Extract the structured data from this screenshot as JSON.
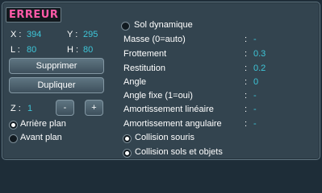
{
  "title": "ERREUR",
  "coords": {
    "x_label": "X :",
    "x_value": "394",
    "y_label": "Y :",
    "y_value": "295",
    "l_label": "L :",
    "l_value": "80",
    "h_label": "H :",
    "h_value": "80"
  },
  "buttons": {
    "delete": "Supprimer",
    "duplicate": "Dupliquer",
    "minus": "-",
    "plus": "+"
  },
  "z": {
    "label": "Z :",
    "value": "1"
  },
  "layer": {
    "background_label": "Arrière plan",
    "foreground_label": "Avant plan",
    "selected": "background"
  },
  "dynamic_ground": {
    "label": "Sol dynamique",
    "checked": false
  },
  "properties": [
    {
      "label": "Masse (0=auto)",
      "value": "-"
    },
    {
      "label": "Frottement",
      "value": "0.3"
    },
    {
      "label": "Restitution",
      "value": "0.2"
    },
    {
      "label": "Angle",
      "value": "0"
    },
    {
      "label": "Angle fixe (1=oui)",
      "value": "-"
    },
    {
      "label": "Amortissement linéaire",
      "value": "-"
    },
    {
      "label": "Amortissement angulaire",
      "value": "-"
    }
  ],
  "colon": ":",
  "collisions": {
    "mouse_label": "Collision souris",
    "mouse_checked": true,
    "objects_label": "Collision sols et objets",
    "objects_checked": true
  },
  "colors": {
    "title": "#ff5aa8",
    "value": "#3ec6d8",
    "panel": "#33444f"
  }
}
